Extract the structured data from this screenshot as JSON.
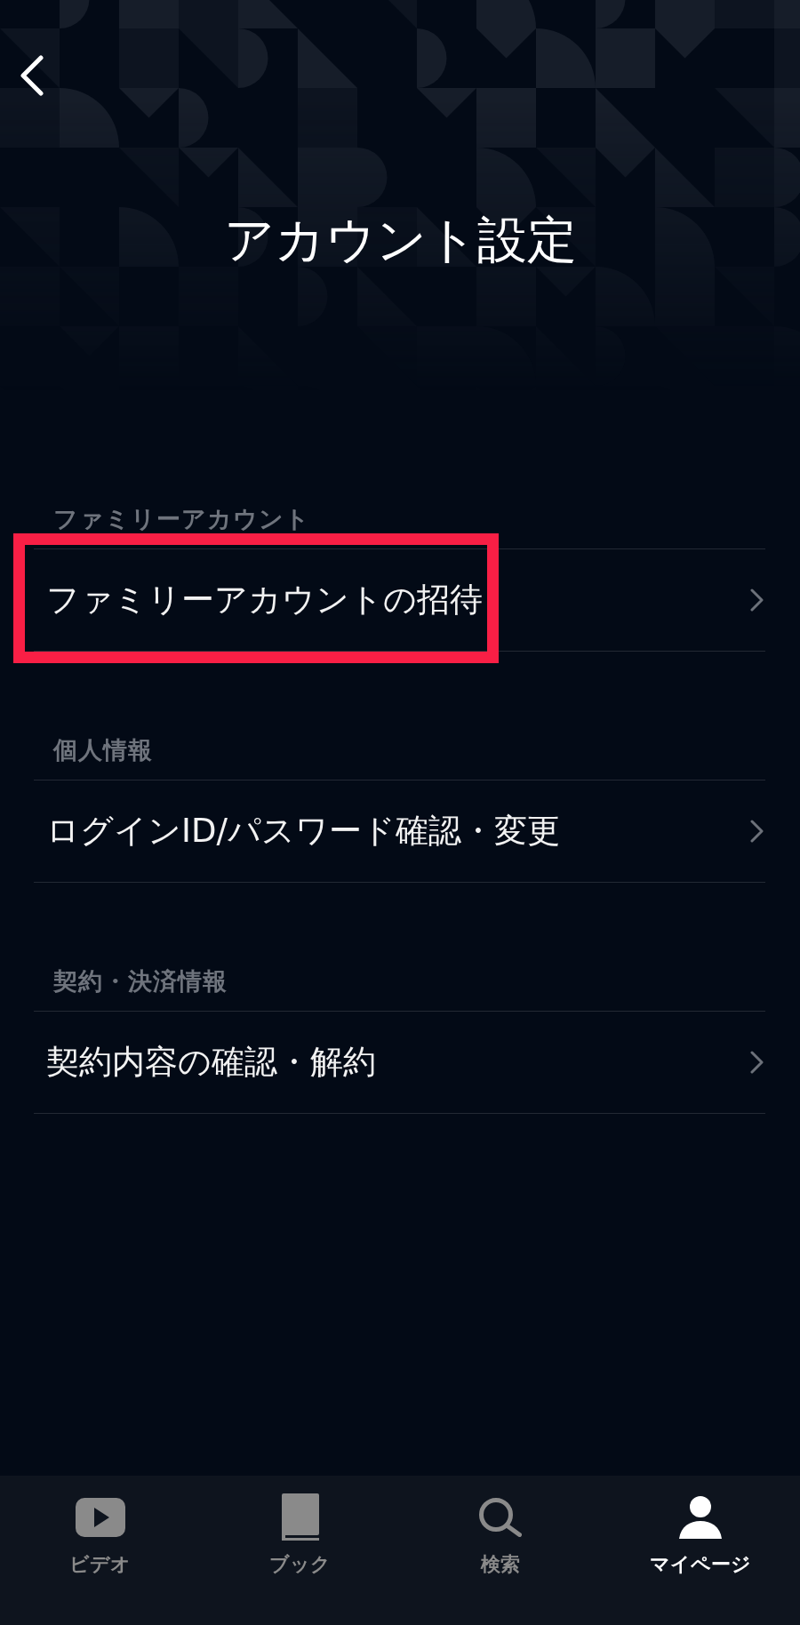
{
  "header": {
    "title": "アカウント設定"
  },
  "sections": [
    {
      "title": "ファミリーアカウント",
      "items": [
        {
          "label": "ファミリーアカウントの招待",
          "highlighted": true
        }
      ]
    },
    {
      "title": "個人情報",
      "items": [
        {
          "label": "ログインID/パスワード確認・変更",
          "highlighted": false
        }
      ]
    },
    {
      "title": "契約・決済情報",
      "items": [
        {
          "label": "契約内容の確認・解約",
          "highlighted": false
        }
      ]
    }
  ],
  "tab_bar": [
    {
      "label": "ビデオ",
      "kind": "video",
      "selected": false
    },
    {
      "label": "ブック",
      "kind": "book",
      "selected": false
    },
    {
      "label": "検索",
      "kind": "search",
      "selected": false
    },
    {
      "label": "マイページ",
      "kind": "profile",
      "selected": true
    }
  ]
}
